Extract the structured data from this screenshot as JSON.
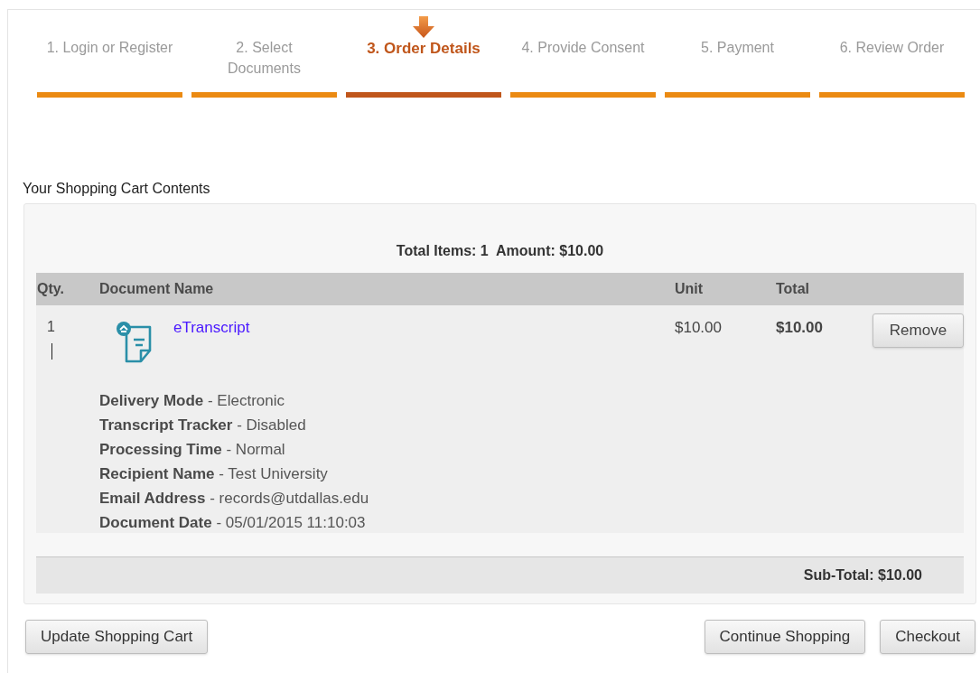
{
  "steps": [
    {
      "label": "1. Login or Register",
      "selected": false
    },
    {
      "label": "2. Select Documents",
      "selected": false
    },
    {
      "label": "3. Order Details",
      "selected": true
    },
    {
      "label": "4. Provide Consent",
      "selected": false
    },
    {
      "label": "5. Payment",
      "selected": false
    },
    {
      "label": "6. Review Order",
      "selected": false
    }
  ],
  "heading": "Your Shopping Cart Contents",
  "summary": "Total Items: 1  Amount: $10.00",
  "table": {
    "columns": [
      "Qty.",
      "Document Name",
      "Unit",
      "Total"
    ],
    "rows": [
      {
        "qty": "1",
        "document": "eTranscript",
        "unit": "$10.00",
        "total": "$10.00",
        "action": "Remove",
        "details": [
          "**Delivery Mode** - Electronic",
          "**Transcript Tracker** - Disabled",
          "**Processing Time** - Normal",
          "**Recipient Name** - Test University",
          "**Email Address** - records@utdallas.edu",
          "**Document Date** - 05/01/2015 11:10:03"
        ]
      }
    ]
  },
  "subtotal": "Sub-Total: $10.00",
  "buttons": {
    "left": "Update Shopping Cart",
    "right": [
      "Continue Shopping",
      "Checkout"
    ]
  }
}
